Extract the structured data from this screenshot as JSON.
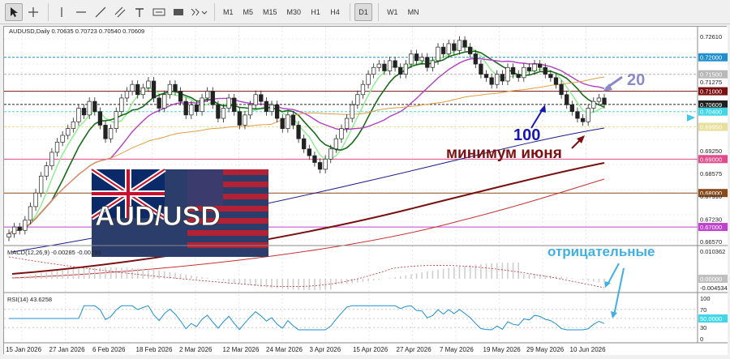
{
  "toolbar": {
    "tools": [
      "cursor-icon",
      "crosshair-icon",
      "vertical-line-icon",
      "horizontal-line-icon",
      "trendline-icon",
      "channel-icon",
      "text-icon",
      "label-icon",
      "rectangle-icon",
      "objects-icon"
    ],
    "timeframes": [
      "M1",
      "M5",
      "M15",
      "M30",
      "H1",
      "H4",
      "D1",
      "W1",
      "MN"
    ],
    "active_timeframe": "D1"
  },
  "chart": {
    "title": "AUDUSD,Daily  0.70635 0.70723 0.70540 0.70609",
    "price_labels": [
      "0.72610",
      "0.72000",
      "0.71500",
      "0.71275",
      "0.71000",
      "0.70609",
      "0.70400",
      "0.69950",
      "0.69250",
      "0.69000",
      "0.68575",
      "0.68000",
      "0.67910",
      "0.67230",
      "0.67000",
      "0.66570"
    ],
    "highlight_levels": [
      {
        "label": "0.72000",
        "color": "#1f8fd0"
      },
      {
        "label": "0.71500",
        "color": "#b8b8b8"
      },
      {
        "label": "0.71000",
        "color": "#7a1010"
      },
      {
        "label": "0.70609",
        "color": "#202020"
      },
      {
        "label": "0.70400",
        "color": "#40d8e8"
      },
      {
        "label": "0.69950",
        "color": "#e8e09a"
      },
      {
        "label": "0.69000",
        "color": "#e24a8a"
      },
      {
        "label": "0.68000",
        "color": "#8a4a1a"
      },
      {
        "label": "0.67000",
        "color": "#c040d0"
      }
    ],
    "date_labels": [
      "15 Jan 2026",
      "27 Jan 2026",
      "6 Feb 2026",
      "18 Feb 2026",
      "2 Mar 2026",
      "12 Mar 2026",
      "24 Mar 2026",
      "3 Apr 2026",
      "15 Apr 2026",
      "27 Apr 2026",
      "7 May 2026",
      "19 May 2026",
      "29 May 2026",
      "10 Jun 2026"
    ],
    "annotation_20": "20",
    "annotation_100": "100",
    "annotation_june_low": "минимум июня",
    "annotation_negative": "отрицательные",
    "logo_text": "AUD/USD"
  },
  "macd": {
    "title": "MACD(12,26,9) -0.00285 -0.00190",
    "labels": [
      "0.010362",
      "0.00000",
      "-0.004534"
    ]
  },
  "rsi": {
    "title": "RSI(14) 43.6258",
    "labels": [
      "100",
      "70",
      "50.0000",
      "30",
      "0"
    ]
  },
  "colors": {
    "bull": "#2e8b2e",
    "ma_fast": "#1a6b1a",
    "ma_light": "#90ee90",
    "ma20": "#b040c0",
    "ma100": "#1a1a8a",
    "ma200": "#7a1010",
    "ma_orange": "#e0a040",
    "annotation_blue": "#1818b0",
    "annotation_maroon": "#7a1010",
    "annotation_cyan": "#40c8e8"
  }
}
